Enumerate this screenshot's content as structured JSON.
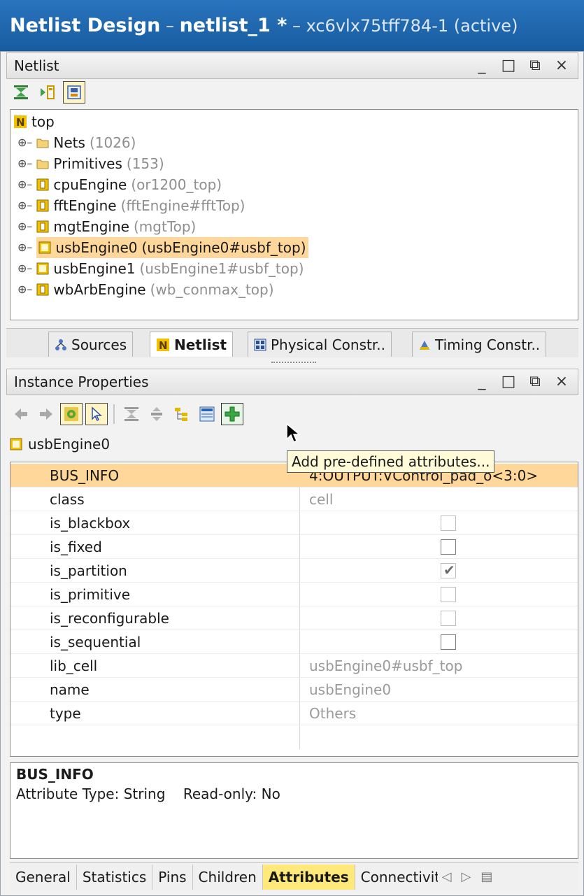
{
  "title": {
    "app": "Netlist Design",
    "sep1": " – ",
    "name": "netlist_1 *",
    "sep2": " – ",
    "device": "xc6vlx75tff784-1 (active)"
  },
  "netlist_panel": {
    "title": "Netlist",
    "window_controls": [
      "_",
      "□",
      "⧉",
      "×"
    ],
    "toolbar": [
      "collapse-all-icon",
      "expand-icon",
      "show-hierarchy-icon"
    ],
    "tree": {
      "root": "top",
      "items": [
        {
          "name": "Nets",
          "detail": "(1026)",
          "kind": "folder"
        },
        {
          "name": "Primitives",
          "detail": "(153)",
          "kind": "folder"
        },
        {
          "name": "cpuEngine",
          "detail": "(or1200_top)",
          "kind": "cell"
        },
        {
          "name": "fftEngine",
          "detail": "(fftEngine#fftTop)",
          "kind": "cell"
        },
        {
          "name": "mgtEngine",
          "detail": "(mgtTop)",
          "kind": "cell"
        },
        {
          "name": "usbEngine0",
          "detail": "(usbEngine0#usbf_top)",
          "kind": "cell-empty",
          "selected": true
        },
        {
          "name": "usbEngine1",
          "detail": "(usbEngine1#usbf_top)",
          "kind": "cell-empty"
        },
        {
          "name": "wbArbEngine",
          "detail": "(wb_conmax_top)",
          "kind": "cell"
        }
      ]
    }
  },
  "view_tabs": [
    {
      "label": "Sources",
      "icon": "sources-icon"
    },
    {
      "label": "Netlist",
      "icon": "netlist-icon",
      "active": true
    },
    {
      "label": "Physical Constr..",
      "icon": "physical-constraints-icon"
    },
    {
      "label": "Timing Constr..",
      "icon": "timing-constraints-icon"
    }
  ],
  "props_panel": {
    "title": "Instance Properties",
    "window_controls": [
      "_",
      "□",
      "⧉",
      "×"
    ],
    "instance": "usbEngine0",
    "tooltip": "Add pre-defined attributes...",
    "rows": [
      {
        "name": "BUS_INFO",
        "value": "4:OUTPUT:VControl_pad_o<3:0>",
        "selected": true
      },
      {
        "name": "class",
        "value": "cell"
      },
      {
        "name": "is_blackbox",
        "checkbox": "disabled"
      },
      {
        "name": "is_fixed",
        "checkbox": "enabled"
      },
      {
        "name": "is_partition",
        "checkbox": "checked"
      },
      {
        "name": "is_primitive",
        "checkbox": "disabled"
      },
      {
        "name": "is_reconfigurable",
        "checkbox": "disabled"
      },
      {
        "name": "is_sequential",
        "checkbox": "enabled"
      },
      {
        "name": "lib_cell",
        "value": "usbEngine0#usbf_top"
      },
      {
        "name": "name",
        "value": "usbEngine0"
      },
      {
        "name": "type",
        "value": "Others"
      }
    ],
    "description": {
      "title": "BUS_INFO",
      "line": "Attribute Type: String    Read-only: No"
    },
    "tabs": [
      {
        "label": "General"
      },
      {
        "label": "Statistics"
      },
      {
        "label": "Pins"
      },
      {
        "label": "Children"
      },
      {
        "label": "Attributes",
        "active": true
      },
      {
        "label": "Connectivit",
        "truncated": true
      }
    ],
    "tab_nav": [
      "◁",
      "▷",
      "▤"
    ]
  }
}
